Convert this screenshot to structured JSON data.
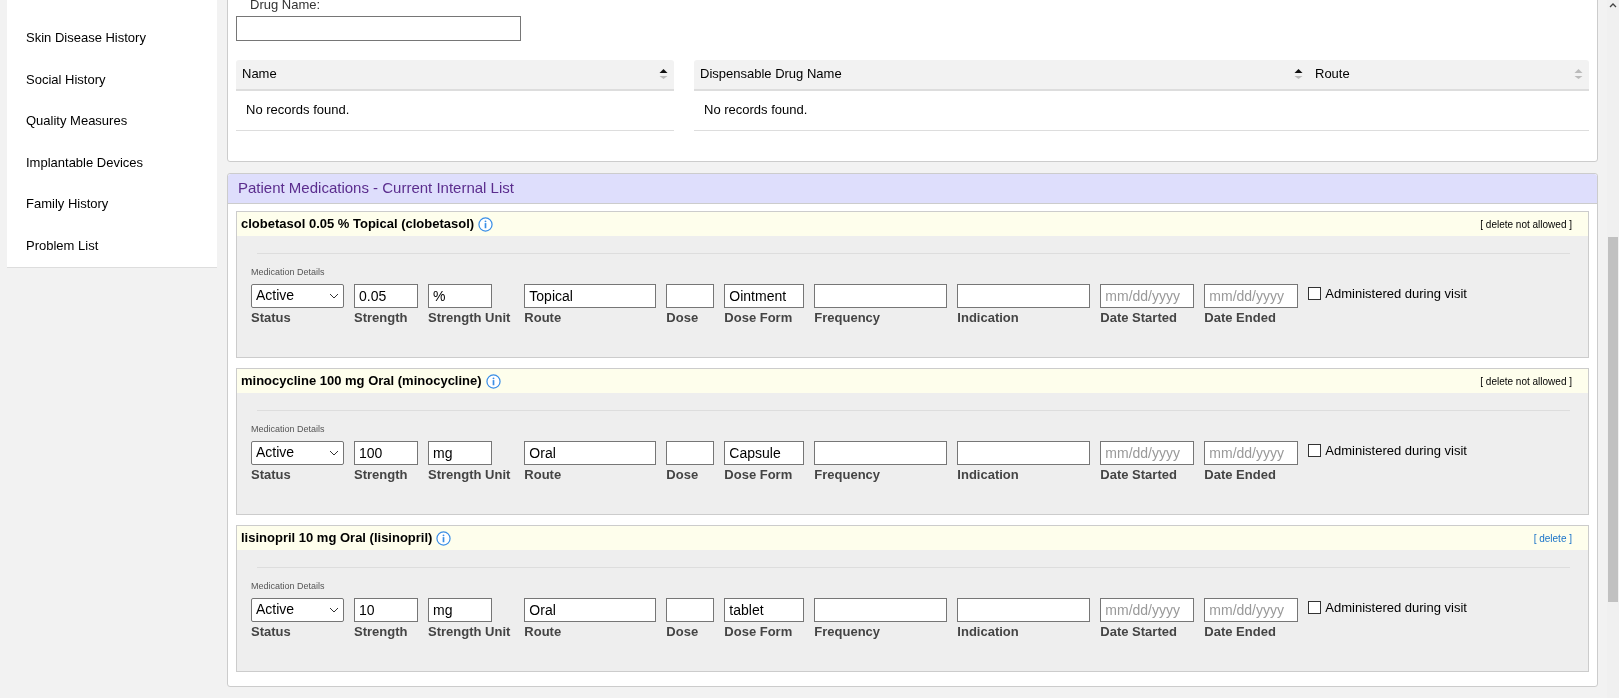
{
  "sidebar": {
    "items": [
      {
        "label": "Skin Disease History"
      },
      {
        "label": "Social History"
      },
      {
        "label": "Quality Measures"
      },
      {
        "label": "Implantable Devices"
      },
      {
        "label": "Family History"
      },
      {
        "label": "Problem List"
      }
    ]
  },
  "drug_search": {
    "label": "Drug Name:"
  },
  "tables": [
    {
      "columns": [
        {
          "label": "Name",
          "sorted": true
        }
      ],
      "empty_text": "No records found."
    },
    {
      "columns": [
        {
          "label": "Dispensable Drug Name",
          "sorted": true
        },
        {
          "label": "Route",
          "sorted": false
        }
      ],
      "empty_text": "No records found."
    }
  ],
  "medications_panel": {
    "title": "Patient Medications - Current Internal List",
    "medications": [
      {
        "name": "clobetasol 0.05 % Topical (clobetasol)",
        "delete_text": "[ delete not allowed ]",
        "delete_allowed": false,
        "section_label": "Medication Details",
        "fields": [
          {
            "kind": "select",
            "label": "Status",
            "value": "Active"
          },
          {
            "kind": "text",
            "label": "Strength",
            "value": "0.05"
          },
          {
            "kind": "text",
            "label": "Strength Unit",
            "value": "%"
          },
          {
            "kind": "text",
            "label": "Route",
            "value": "Topical"
          },
          {
            "kind": "text",
            "label": "Dose"
          },
          {
            "kind": "text",
            "label": "Dose Form",
            "value": "Ointment"
          },
          {
            "kind": "text",
            "label": "Frequency"
          },
          {
            "kind": "text",
            "label": "Indication"
          },
          {
            "kind": "date",
            "label": "Date Started",
            "placeholder": "mm/dd/yyyy"
          },
          {
            "kind": "date",
            "label": "Date Ended",
            "placeholder": "mm/dd/yyyy"
          }
        ],
        "administered": {
          "label": "Administered during visit",
          "checked": false
        }
      },
      {
        "name": "minocycline 100 mg Oral (minocycline)",
        "delete_text": "[ delete not allowed ]",
        "delete_allowed": false,
        "section_label": "Medication Details",
        "fields": [
          {
            "kind": "select",
            "label": "Status",
            "value": "Active"
          },
          {
            "kind": "text",
            "label": "Strength",
            "value": "100"
          },
          {
            "kind": "text",
            "label": "Strength Unit",
            "value": "mg"
          },
          {
            "kind": "text",
            "label": "Route",
            "value": "Oral"
          },
          {
            "kind": "text",
            "label": "Dose"
          },
          {
            "kind": "text",
            "label": "Dose Form",
            "value": "Capsule"
          },
          {
            "kind": "text",
            "label": "Frequency"
          },
          {
            "kind": "text",
            "label": "Indication"
          },
          {
            "kind": "date",
            "label": "Date Started",
            "placeholder": "mm/dd/yyyy"
          },
          {
            "kind": "date",
            "label": "Date Ended",
            "placeholder": "mm/dd/yyyy"
          }
        ],
        "administered": {
          "label": "Administered during visit",
          "checked": false
        }
      },
      {
        "name": "lisinopril 10 mg Oral (lisinopril)",
        "delete_text": "[ delete ]",
        "delete_allowed": true,
        "section_label": "Medication Details",
        "fields": [
          {
            "kind": "select",
            "label": "Status",
            "value": "Active"
          },
          {
            "kind": "text",
            "label": "Strength",
            "value": "10"
          },
          {
            "kind": "text",
            "label": "Strength Unit",
            "value": "mg"
          },
          {
            "kind": "text",
            "label": "Route",
            "value": "Oral"
          },
          {
            "kind": "text",
            "label": "Dose"
          },
          {
            "kind": "text",
            "label": "Dose Form",
            "value": "tablet"
          },
          {
            "kind": "text",
            "label": "Frequency"
          },
          {
            "kind": "text",
            "label": "Indication"
          },
          {
            "kind": "date",
            "label": "Date Started",
            "placeholder": "mm/dd/yyyy"
          },
          {
            "kind": "date",
            "label": "Date Ended",
            "placeholder": "mm/dd/yyyy"
          }
        ],
        "administered": {
          "label": "Administered during visit",
          "checked": false
        }
      }
    ]
  }
}
